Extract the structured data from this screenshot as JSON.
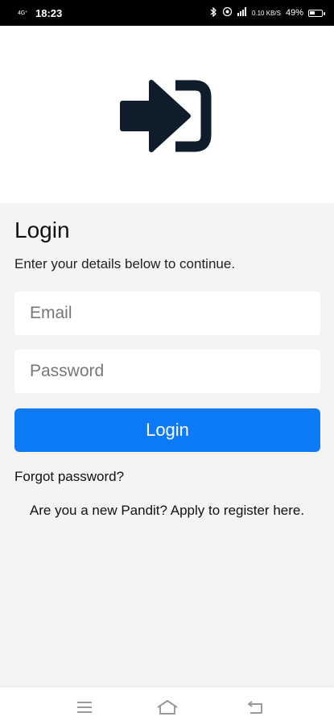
{
  "status_bar": {
    "network": "4G⁺",
    "time": "18:23",
    "speed": "0.10 KB/S",
    "battery_percent": "49%",
    "battery_level": 0.49
  },
  "hero": {
    "logo_icon": "login-enter-icon"
  },
  "form": {
    "title": "Login",
    "subtitle": "Enter your details below to continue.",
    "email_placeholder": "Email",
    "password_placeholder": "Password",
    "login_button": "Login",
    "forgot_link": "Forgot password?",
    "register_text": "Are you a new Pandit? Apply to register here."
  },
  "nav_bar": {
    "icons": [
      "menu-icon",
      "home-icon",
      "back-icon"
    ]
  },
  "colors": {
    "accent": "#0d7bf7",
    "logo": "#0f1d2b",
    "background": "#f4f4f5"
  }
}
